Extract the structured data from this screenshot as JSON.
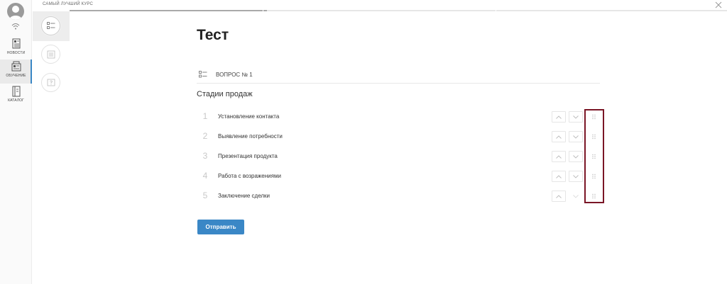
{
  "topbar": {
    "title": "САМЫЙ ЛУЧШИЙ КУРС",
    "close_icon": "close-icon",
    "progress_percent": 30
  },
  "sidebar": {
    "avatar_icon": "user-avatar-icon",
    "status_icon": "wifi-icon",
    "items": [
      {
        "label": "НОВОСТИ",
        "icon": "news-icon",
        "active": false
      },
      {
        "label": "ОБУЧЕНИЕ",
        "icon": "learning-icon",
        "active": true
      },
      {
        "label": "КАТАЛОГ",
        "icon": "catalog-icon",
        "active": false
      }
    ]
  },
  "steps": [
    {
      "icon": "checklist-icon",
      "current": true
    },
    {
      "icon": "document-icon",
      "current": false
    },
    {
      "icon": "question-icon",
      "current": false
    }
  ],
  "main": {
    "title": "Тест",
    "question_label": "ВОПРОС № 1",
    "question_text": "Стадии продаж",
    "answers": [
      {
        "num": "1",
        "text": "Установление контакта"
      },
      {
        "num": "2",
        "text": "Выявление потребности"
      },
      {
        "num": "3",
        "text": "Презентация продукта"
      },
      {
        "num": "4",
        "text": "Работа с возражениями"
      },
      {
        "num": "5",
        "text": "Заключение сделки"
      }
    ],
    "submit_label": "Отправить"
  },
  "colors": {
    "accent": "#3a87c6",
    "highlight": "#7a1626"
  }
}
